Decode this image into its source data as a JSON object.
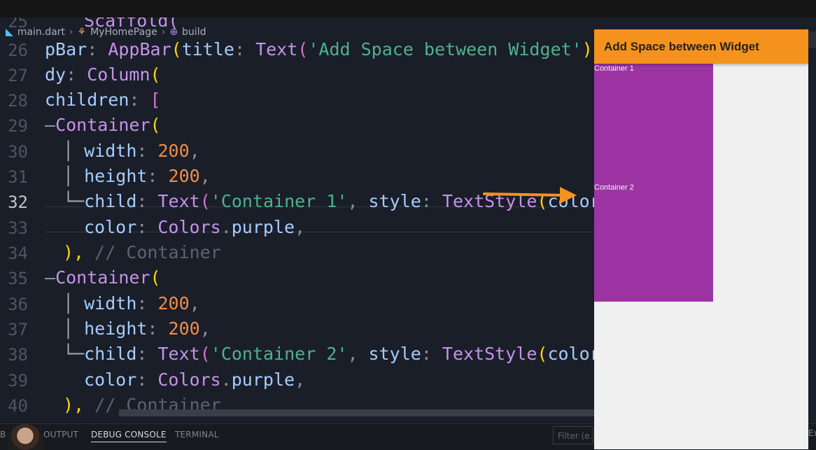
{
  "breadcrumb": {
    "file": "main.dart",
    "class_name": "MyHomePage",
    "method": "build"
  },
  "gutter": [
    "25",
    "26",
    "27",
    "28",
    "29",
    "30",
    "31",
    "32",
    "33",
    "34",
    "35",
    "36",
    "37",
    "38",
    "39",
    "40"
  ],
  "code": {
    "l25": "Scaffold(",
    "l26": {
      "a": "pBar",
      "b": ": ",
      "c": "AppBar",
      "d": "(",
      "e": "title",
      "f": ": ",
      "g": "Text",
      "h": "(",
      "i": "'Add Space between Widget'",
      "j": "))"
    },
    "l27": {
      "a": "dy",
      "b": ": ",
      "c": "Column",
      "d": "("
    },
    "l28": {
      "a": "children",
      "b": ": ",
      "c": "["
    },
    "l29": {
      "a": "—",
      "b": "Container",
      "c": "("
    },
    "l30": {
      "a": "│ ",
      "b": "width",
      "c": ": ",
      "d": "200",
      "e": ","
    },
    "l31": {
      "a": "│ ",
      "b": "height",
      "c": ": ",
      "d": "200",
      "e": ","
    },
    "l32": {
      "a": "└─",
      "b": "child",
      "c": ": ",
      "d": "Text",
      "e": "(",
      "f": "'Container 1'",
      "g": ", ",
      "h": "style",
      "i": ": ",
      "j": "TextStyle",
      "k": "(",
      "l": "color"
    },
    "l33": {
      "a": "color",
      "b": ": ",
      "c": "Colors",
      "d": ".",
      "e": "purple",
      "f": ","
    },
    "l34": {
      "a": "),",
      "b": " // Container"
    },
    "l35": {
      "a": "—",
      "b": "Container",
      "c": "("
    },
    "l36": {
      "a": "│ ",
      "b": "width",
      "c": ": ",
      "d": "200",
      "e": ","
    },
    "l37": {
      "a": "│ ",
      "b": "height",
      "c": ": ",
      "d": "200",
      "e": ","
    },
    "l38": {
      "a": "└─",
      "b": "child",
      "c": ": ",
      "d": "Text",
      "e": "(",
      "f": "'Container 2'",
      "g": ", ",
      "h": "style",
      "i": ": ",
      "j": "TextStyle",
      "k": "(",
      "l": "color"
    },
    "l39": {
      "a": "color",
      "b": ": ",
      "c": "Colors",
      "d": ".",
      "e": "purple",
      "f": ","
    },
    "l40": {
      "a": "),",
      "b": " // Container"
    }
  },
  "debug_toolbar": {
    "grip": "⠿",
    "pause": "❚❚",
    "step_over": "↷",
    "step_into": "↓",
    "step_out": "↑",
    "hot_reload": "⚡"
  },
  "app_preview": {
    "appbar_title": "Add Space between Widget",
    "container1_label": "Container 1",
    "container2_label": "Container 2",
    "accent_color": "#f5921e",
    "container_color": "#9c34a3"
  },
  "panel": {
    "tab_output": "OUTPUT",
    "tab_debug_console": "DEBUG CONSOLE",
    "tab_terminal": "TERMINAL",
    "filter_placeholder": "Filter (e.g.",
    "left_fragment": "B",
    "right_fragment": "Ex"
  }
}
